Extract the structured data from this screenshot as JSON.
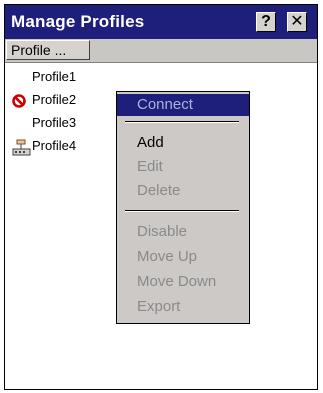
{
  "window": {
    "title": "Manage Profiles",
    "help_label": "?",
    "close_label": "✕"
  },
  "list_header": {
    "column_label": "Profile ..."
  },
  "profiles": [
    {
      "name": "Profile1",
      "icon": ""
    },
    {
      "name": "Profile2",
      "icon": "disabled-icon"
    },
    {
      "name": "Profile3",
      "icon": ""
    },
    {
      "name": "Profile4",
      "icon": "network-icon"
    }
  ],
  "context_menu": {
    "items": [
      {
        "label": "Connect",
        "state": "highlighted-disabled"
      },
      {
        "label": "Add",
        "state": "enabled"
      },
      {
        "label": "Edit",
        "state": "disabled"
      },
      {
        "label": "Delete",
        "state": "disabled"
      },
      {
        "label": "Disable",
        "state": "disabled"
      },
      {
        "label": "Move Up",
        "state": "disabled"
      },
      {
        "label": "Move Down",
        "state": "disabled"
      },
      {
        "label": "Export",
        "state": "disabled"
      }
    ]
  },
  "colors": {
    "titlebar": "#1d1f7b",
    "menu_bg": "#ccc9c6",
    "disabled_text": "#8a8a8a",
    "disabled_icon": "#cc0000"
  }
}
